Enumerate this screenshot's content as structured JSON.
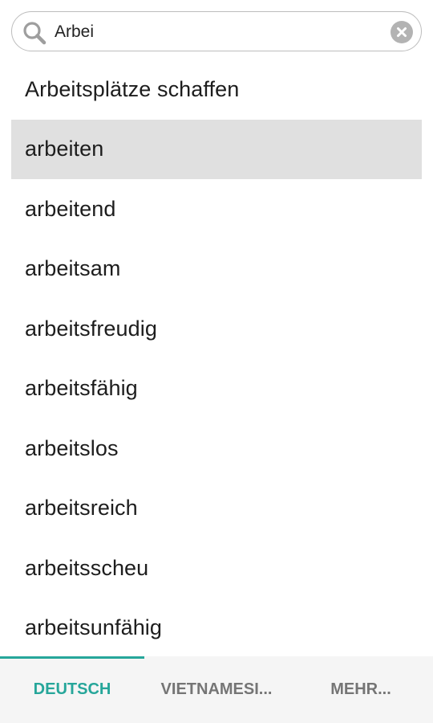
{
  "search": {
    "value": "Arbei",
    "search_icon": "search-icon",
    "clear_icon": "clear-icon"
  },
  "suggestions": [
    {
      "label": "Arbeitsplätze schaffen",
      "selected": false
    },
    {
      "label": "arbeiten",
      "selected": true
    },
    {
      "label": "arbeitend",
      "selected": false
    },
    {
      "label": "arbeitsam",
      "selected": false
    },
    {
      "label": "arbeitsfreudig",
      "selected": false
    },
    {
      "label": "arbeitsfähig",
      "selected": false
    },
    {
      "label": "arbeitslos",
      "selected": false
    },
    {
      "label": "arbeitsreich",
      "selected": false
    },
    {
      "label": "arbeitsscheu",
      "selected": false
    },
    {
      "label": "arbeitsunfähig",
      "selected": false
    }
  ],
  "tabs": [
    {
      "label": "DEUTSCH",
      "active": true
    },
    {
      "label": "VIETNAMESI...",
      "active": false
    },
    {
      "label": "MEHR...",
      "active": false
    }
  ],
  "colors": {
    "accent": "#26a69a",
    "selected_row": "#e0e0e0",
    "tab_bar": "#f5f5f5"
  }
}
